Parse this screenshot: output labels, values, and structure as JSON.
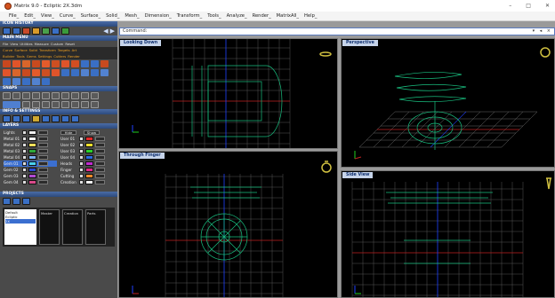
{
  "app": {
    "title": "Matrix 9.0 - Ecliptic 2X.3dm"
  },
  "window_controls": {
    "minimize": "–",
    "maximize": "□",
    "close": "✕"
  },
  "menubar": {
    "items": [
      "File_",
      "Edit_",
      "View_",
      "Curve_",
      "Surface_",
      "Solid_",
      "Mesh_",
      "Dimension_",
      "Transform_",
      "Tools_",
      "Analyze_",
      "Render_",
      "MatrixAll_",
      "Help_"
    ]
  },
  "panel": {
    "icon_history": "ICON HISTORY",
    "main_menu": "MAIN MENU",
    "main_menu_tabs": [
      "File",
      "View",
      "Utilities",
      "Measure",
      "Custom",
      "Reset"
    ],
    "category_row1": [
      "Curve",
      "Surface",
      "Solid",
      "Transform",
      "Targets",
      "Art"
    ],
    "category_row2": [
      "Builder",
      "Tools",
      "Gems",
      "Settings",
      "Cutters",
      "Render"
    ],
    "snaps": "SNAPS",
    "info_settings": "INFO & SETTINGS",
    "layers": "LAYERS",
    "layers_header": {
      "col1": "Lights",
      "hide": "Hide",
      "show": "Show"
    },
    "layers_left": [
      "Lights",
      "Metal 01",
      "Metal 02",
      "Metal 03",
      "Metal 04",
      "Gem 01",
      "Gem 02",
      "Gem 03",
      "Gem 04"
    ],
    "layers_right": [
      "User 01",
      "User 02",
      "User 03",
      "User 04",
      "Heads",
      "Finger",
      "Cutting",
      "Creation"
    ],
    "projects": "PROJECTS",
    "project_list": [
      "Default",
      "Ecliptic",
      "2X"
    ],
    "project_thumbs": [
      "Master",
      "Creation",
      "Parts"
    ]
  },
  "command": {
    "label": "Command:",
    "controls": "▾ ◂ ×"
  },
  "viewports": {
    "top": "Looking Down",
    "perspective": "Perspective",
    "front": "Through Finger",
    "right": "Side View"
  },
  "colors": {
    "grid": "#5a5a5a",
    "grid_major": "#9a9a9a",
    "curve": "#19c080",
    "axis_x": "#d02020",
    "axis_y": "#2040ff",
    "axis_z": "#20d020",
    "label_bg": "#c6d4ea"
  }
}
